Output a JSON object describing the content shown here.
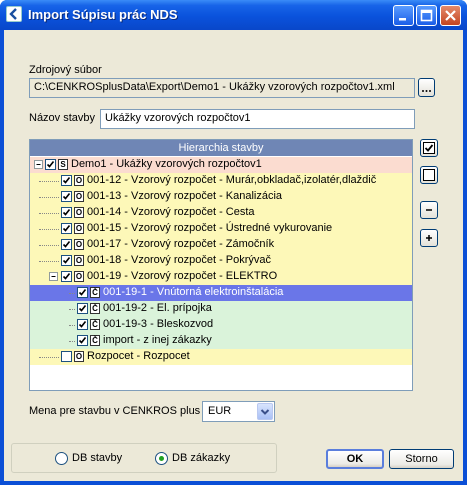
{
  "window": {
    "title": "Import Súpisu prác NDS",
    "colors": {
      "titlebar": "#0a52dc",
      "face": "#ece9d8",
      "selection": "#6a76e8"
    }
  },
  "source": {
    "label": "Zdrojový súbor",
    "path": "C:\\CENKROSplusData\\Export\\Demo1 - Ukážky vzorových rozpočtov1.xml",
    "browse_label": "..."
  },
  "project": {
    "label": "Názov stavby",
    "value": "Ukážky vzorových rozpočtov1"
  },
  "tree": {
    "header": "Hierarchia stavby",
    "rows": [
      {
        "icon": "S",
        "label": "Demo1 - Ukážky vzorových rozpočtov1"
      },
      {
        "icon": "O",
        "label": "001-12 - Vzorový rozpočet - Murár,obkladač,izolatér,dlaždič"
      },
      {
        "icon": "O",
        "label": "001-13 - Vzorový rozpočet - Kanalizácia"
      },
      {
        "icon": "O",
        "label": "001-14 - Vzorový rozpočet - Cesta"
      },
      {
        "icon": "O",
        "label": "001-15 - Vzorový rozpočet - Ústredné vykurovanie"
      },
      {
        "icon": "O",
        "label": "001-17 - Vzorový rozpočet - Zámočník"
      },
      {
        "icon": "O",
        "label": "001-18 - Vzorový rozpočet - Pokrývač"
      },
      {
        "icon": "O",
        "label": "001-19 - Vzorový rozpočet - ELEKTRO"
      },
      {
        "icon": "Č",
        "label": "001-19-1 - Vnútorná elektroinštalácia"
      },
      {
        "icon": "Č",
        "label": "001-19-2 - El. prípojka"
      },
      {
        "icon": "Č",
        "label": "001-19-3 - Bleskozvod"
      },
      {
        "icon": "Č",
        "label": "import - z inej zákazky"
      },
      {
        "icon": "O",
        "label": "Rozpocet - Rozpocet"
      }
    ]
  },
  "side_buttons": {
    "check_all": "check-all",
    "uncheck_all": "uncheck-all",
    "collapse": "-",
    "expand": "+"
  },
  "currency": {
    "label": "Mena pre stavbu v CENKROS plus",
    "value": "EUR"
  },
  "db": {
    "option_stavby": "DB stavby",
    "option_zakazky": "DB zákazky",
    "selected": "DB zákazky"
  },
  "actions": {
    "ok": "OK",
    "cancel": "Storno"
  }
}
